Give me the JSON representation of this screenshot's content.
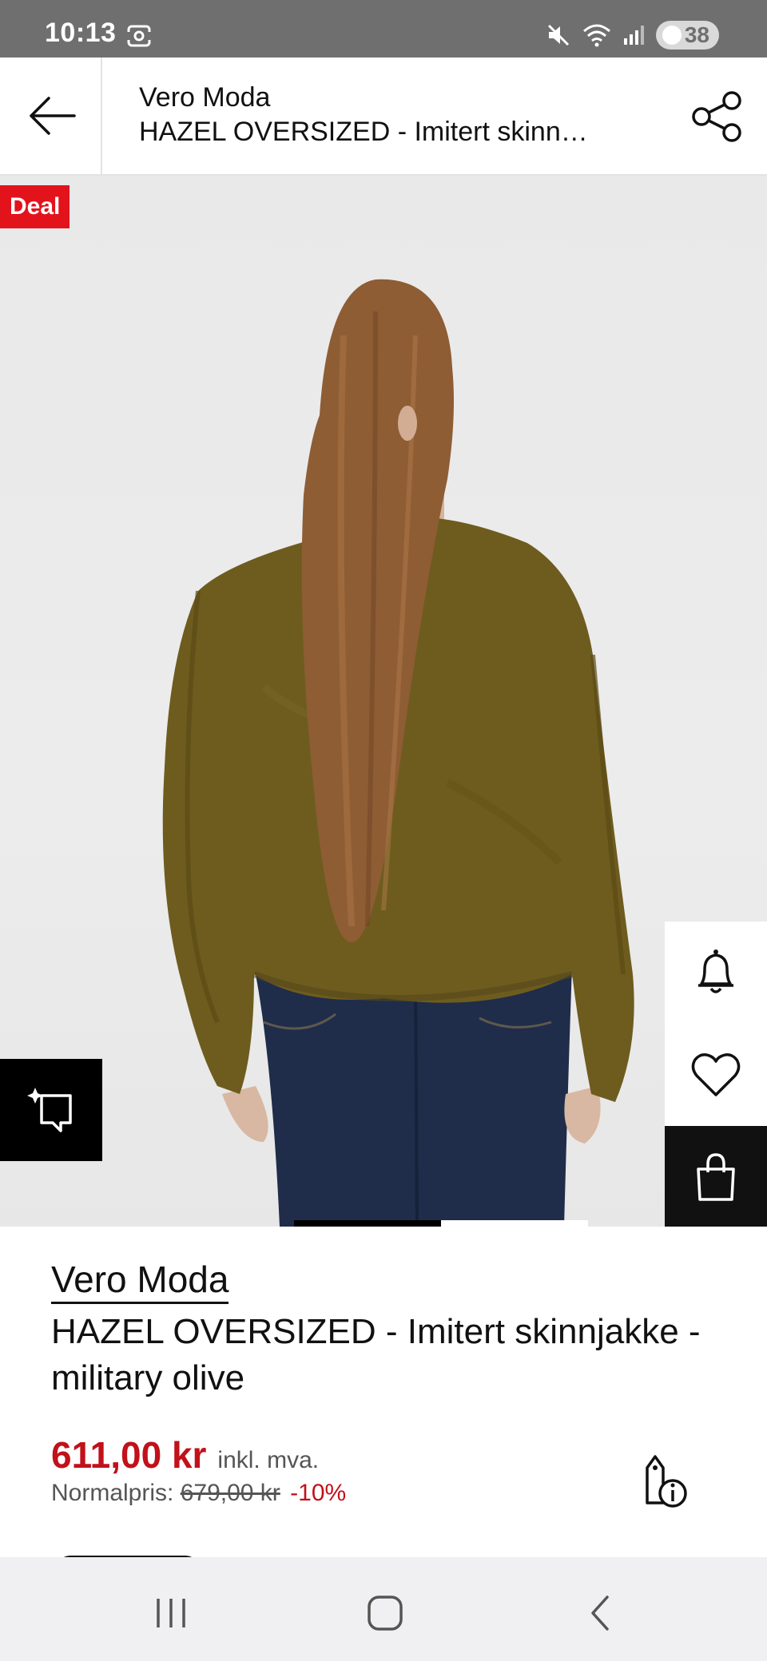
{
  "status_bar": {
    "time": "10:13",
    "battery": "38",
    "icons": [
      "screenshot-icon",
      "mute-icon",
      "wifi-icon",
      "signal-icon",
      "battery-icon"
    ]
  },
  "header": {
    "brand": "Vero Moda",
    "title": "HAZEL OVERSIZED - Imitert skinn…",
    "back_icon": "arrow-left-icon",
    "share_icon": "share-icon"
  },
  "hero": {
    "deal_label": "Deal",
    "image_description_icon": "product-photo",
    "actions": [
      "bell-icon",
      "heart-icon",
      "shopping-bag-icon"
    ],
    "ai_icon": "sparkle-chat-icon",
    "gallery_position": 1,
    "gallery_count": 2
  },
  "product": {
    "brand": "Vero Moda",
    "name": "HAZEL OVERSIZED - Imitert skinnjakke - military olive",
    "price": "611,00 kr",
    "vat_note": "inkl. mva.",
    "normal_label": "Normalpris:",
    "old_price": "679,00 kr",
    "discount": "-10%"
  },
  "nav_bar": {
    "buttons": [
      "recents-icon",
      "home-icon",
      "back-icon"
    ]
  },
  "colors": {
    "accent_red": "#c1111a",
    "deal_red": "#e3131b",
    "jacket_olive": "#6e5c1e"
  }
}
